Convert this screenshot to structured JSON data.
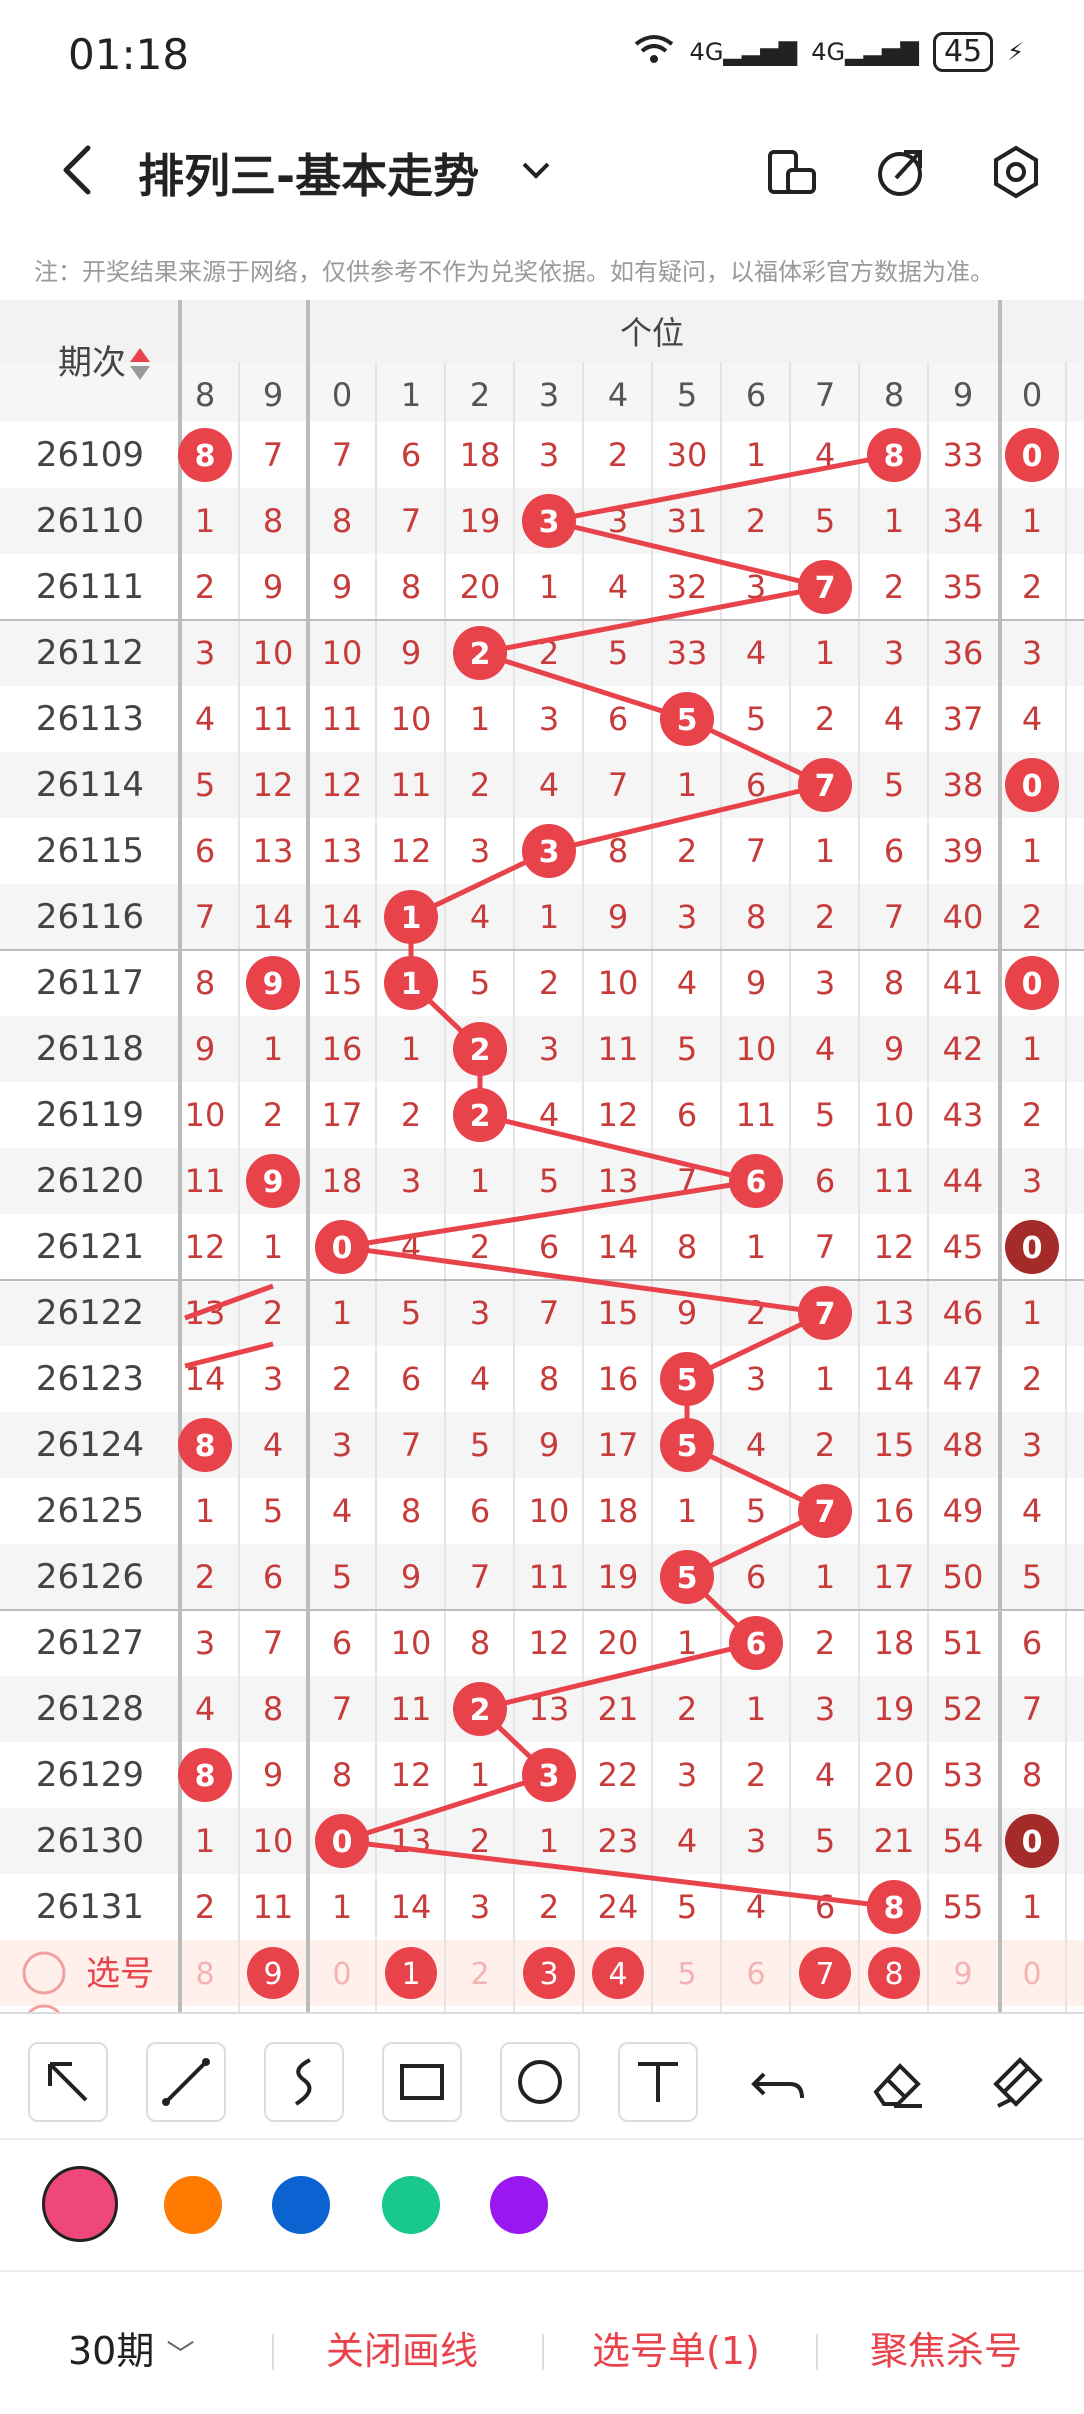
{
  "status": {
    "time": "01:18",
    "network": [
      "4G",
      "4G"
    ],
    "battery": "45"
  },
  "header": {
    "title": "排列三-基本走势",
    "icons": [
      "back-icon",
      "chevron-down-icon",
      "screen-rotate-icon",
      "share-icon",
      "settings-icon"
    ]
  },
  "note": "注：开奖结果来源于网络，仅供参考不作为兑奖依据。如有疑问，以福体彩官方数据为准。",
  "grid": {
    "period_header": "期次",
    "section_label": "个位",
    "col_headers": [
      "8",
      "9",
      "0",
      "1",
      "2",
      "3",
      "4",
      "5",
      "6",
      "7",
      "8",
      "9",
      "0"
    ],
    "rows": [
      {
        "p": "26109",
        "v": [
          "8",
          "7",
          "7",
          "6",
          "18",
          "3",
          "2",
          "30",
          "1",
          "4",
          "8",
          "33",
          "0"
        ]
      },
      {
        "p": "26110",
        "v": [
          "1",
          "8",
          "8",
          "7",
          "19",
          "3",
          "3",
          "31",
          "2",
          "5",
          "1",
          "34",
          "1"
        ]
      },
      {
        "p": "26111",
        "v": [
          "2",
          "9",
          "9",
          "8",
          "20",
          "1",
          "4",
          "32",
          "3",
          "7",
          "2",
          "35",
          "2"
        ]
      },
      {
        "p": "26112",
        "v": [
          "3",
          "10",
          "10",
          "9",
          "2",
          "2",
          "5",
          "33",
          "4",
          "1",
          "3",
          "36",
          "3"
        ]
      },
      {
        "p": "26113",
        "v": [
          "4",
          "11",
          "11",
          "10",
          "1",
          "3",
          "6",
          "5",
          "5",
          "2",
          "4",
          "37",
          "4"
        ]
      },
      {
        "p": "26114",
        "v": [
          "5",
          "12",
          "12",
          "11",
          "2",
          "4",
          "7",
          "1",
          "6",
          "7",
          "5",
          "38",
          "0"
        ]
      },
      {
        "p": "26115",
        "v": [
          "6",
          "13",
          "13",
          "12",
          "3",
          "3",
          "8",
          "2",
          "7",
          "1",
          "6",
          "39",
          "1"
        ]
      },
      {
        "p": "26116",
        "v": [
          "7",
          "14",
          "14",
          "1",
          "4",
          "1",
          "9",
          "3",
          "8",
          "2",
          "7",
          "40",
          "2"
        ]
      },
      {
        "p": "26117",
        "v": [
          "8",
          "9",
          "15",
          "1",
          "5",
          "2",
          "10",
          "4",
          "9",
          "3",
          "8",
          "41",
          "0"
        ]
      },
      {
        "p": "26118",
        "v": [
          "9",
          "1",
          "16",
          "1",
          "2",
          "3",
          "11",
          "5",
          "10",
          "4",
          "9",
          "42",
          "1"
        ]
      },
      {
        "p": "26119",
        "v": [
          "10",
          "2",
          "17",
          "2",
          "2",
          "4",
          "12",
          "6",
          "11",
          "5",
          "10",
          "43",
          "2"
        ]
      },
      {
        "p": "26120",
        "v": [
          "11",
          "9",
          "18",
          "3",
          "1",
          "5",
          "13",
          "7",
          "6",
          "6",
          "11",
          "44",
          "3"
        ]
      },
      {
        "p": "26121",
        "v": [
          "12",
          "1",
          "0",
          "4",
          "2",
          "6",
          "14",
          "8",
          "1",
          "7",
          "12",
          "45",
          "0"
        ]
      },
      {
        "p": "26122",
        "v": [
          "13",
          "2",
          "1",
          "5",
          "3",
          "7",
          "15",
          "9",
          "2",
          "7",
          "13",
          "46",
          "1"
        ]
      },
      {
        "p": "26123",
        "v": [
          "14",
          "3",
          "2",
          "6",
          "4",
          "8",
          "16",
          "5",
          "3",
          "1",
          "14",
          "47",
          "2"
        ]
      },
      {
        "p": "26124",
        "v": [
          "8",
          "4",
          "3",
          "7",
          "5",
          "9",
          "17",
          "5",
          "4",
          "2",
          "15",
          "48",
          "3"
        ]
      },
      {
        "p": "26125",
        "v": [
          "1",
          "5",
          "4",
          "8",
          "6",
          "10",
          "18",
          "1",
          "5",
          "7",
          "16",
          "49",
          "4"
        ]
      },
      {
        "p": "26126",
        "v": [
          "2",
          "6",
          "5",
          "9",
          "7",
          "11",
          "19",
          "5",
          "6",
          "1",
          "17",
          "50",
          "5"
        ]
      },
      {
        "p": "26127",
        "v": [
          "3",
          "7",
          "6",
          "10",
          "8",
          "12",
          "20",
          "1",
          "6",
          "2",
          "18",
          "51",
          "6"
        ]
      },
      {
        "p": "26128",
        "v": [
          "4",
          "8",
          "7",
          "11",
          "2",
          "13",
          "21",
          "2",
          "1",
          "3",
          "19",
          "52",
          "7"
        ]
      },
      {
        "p": "26129",
        "v": [
          "8",
          "9",
          "8",
          "12",
          "1",
          "3",
          "22",
          "3",
          "2",
          "4",
          "20",
          "53",
          "8"
        ]
      },
      {
        "p": "26130",
        "v": [
          "1",
          "10",
          "0",
          "13",
          "2",
          "1",
          "23",
          "4",
          "3",
          "5",
          "21",
          "54",
          "0"
        ]
      },
      {
        "p": "26131",
        "v": [
          "2",
          "11",
          "1",
          "14",
          "3",
          "2",
          "24",
          "5",
          "4",
          "6",
          "8",
          "55",
          "1"
        ]
      }
    ],
    "hits": [
      [
        0,
        0
      ],
      [
        0,
        10
      ],
      [
        0,
        12
      ],
      [
        1,
        5
      ],
      [
        2,
        9
      ],
      [
        3,
        4
      ],
      [
        4,
        7
      ],
      [
        5,
        9
      ],
      [
        5,
        12
      ],
      [
        6,
        5
      ],
      [
        7,
        3
      ],
      [
        8,
        1
      ],
      [
        8,
        3
      ],
      [
        8,
        12
      ],
      [
        9,
        4
      ],
      [
        10,
        4
      ],
      [
        11,
        1
      ],
      [
        11,
        8
      ],
      [
        12,
        2
      ],
      [
        12,
        12
      ],
      [
        13,
        9
      ],
      [
        14,
        7
      ],
      [
        15,
        0
      ],
      [
        15,
        7
      ],
      [
        16,
        9
      ],
      [
        17,
        7
      ],
      [
        18,
        8
      ],
      [
        19,
        4
      ],
      [
        20,
        0
      ],
      [
        20,
        5
      ],
      [
        21,
        2
      ],
      [
        21,
        12
      ],
      [
        22,
        10
      ]
    ],
    "dark_hits": [
      [
        12,
        12
      ],
      [
        21,
        12
      ]
    ],
    "select_row": {
      "label": "选号",
      "values": [
        "8",
        "9",
        "0",
        "1",
        "2",
        "3",
        "4",
        "5",
        "6",
        "7",
        "8",
        "9",
        "0"
      ],
      "selected": [
        1,
        3,
        5,
        6,
        9,
        10
      ]
    }
  },
  "tools": [
    "arrow-icon",
    "line-icon",
    "curve-icon",
    "rectangle-icon",
    "circle-icon",
    "text-icon",
    "undo-icon",
    "eraser-icon",
    "clear-icon"
  ],
  "palette": [
    "#f0477a",
    "#ff7a00",
    "#0a63d0",
    "#19c98b",
    "#9b17f0"
  ],
  "bottom": {
    "period": "30期",
    "close_draw": "关闭画线",
    "pick_list": "选号单(1)",
    "focus_kill": "聚焦杀号"
  },
  "colors": {
    "accent": "#e8424a",
    "line": "#e8424a",
    "dark_ball": "#a52a2a",
    "number": "#d63a3a"
  }
}
